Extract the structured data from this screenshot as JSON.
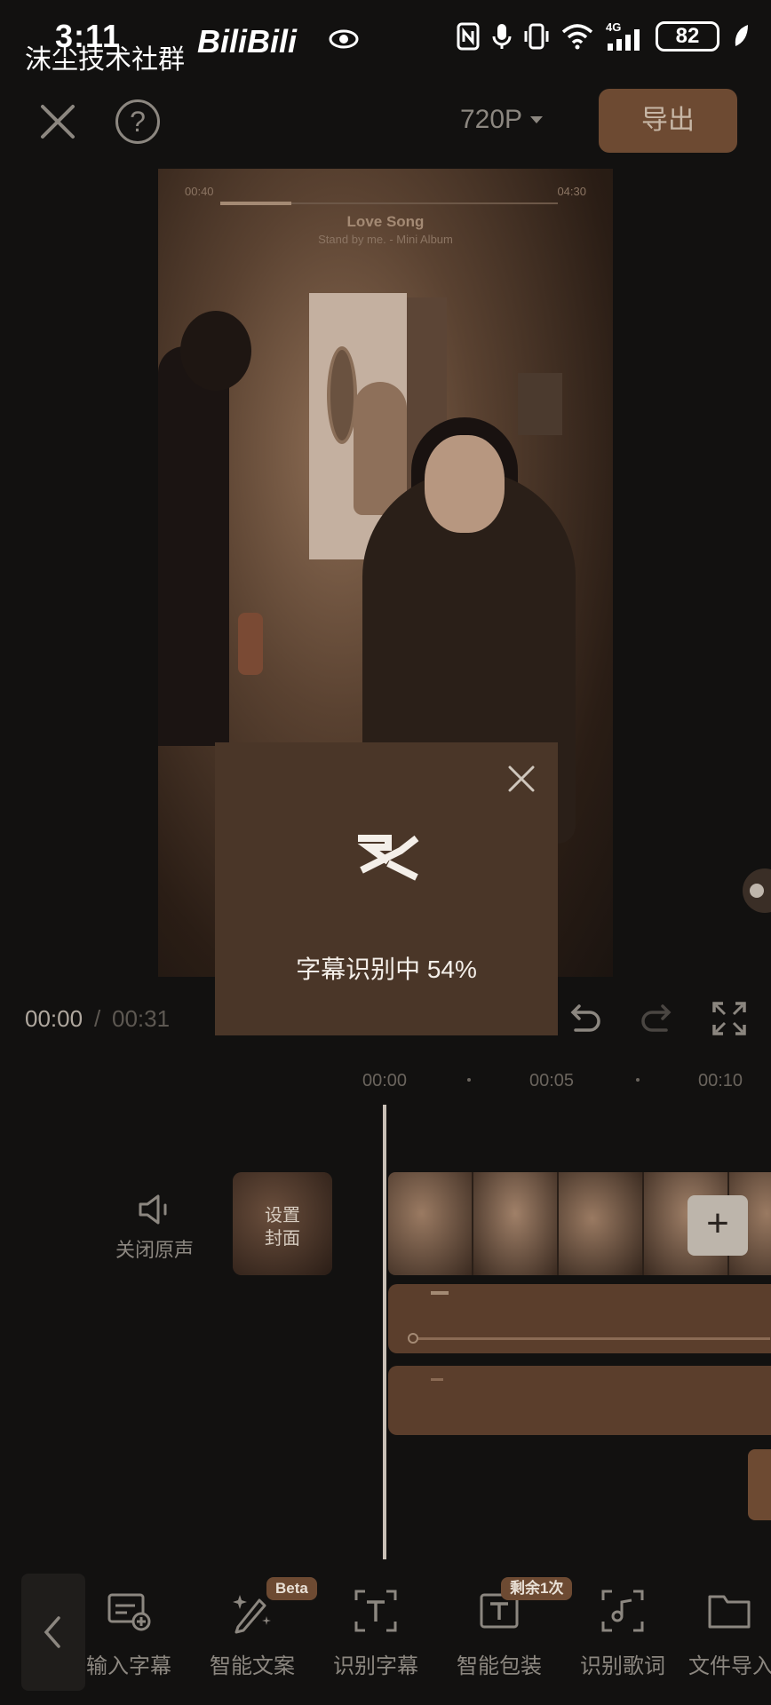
{
  "status_bar": {
    "time": "3:11",
    "watermark": "沫尘技术社群",
    "app_logo": "BiliBili",
    "battery": "82",
    "network": "4G"
  },
  "header": {
    "resolution": "720P",
    "export_label": "导出"
  },
  "preview": {
    "music_time_left": "00:40",
    "music_time_right": "04:30",
    "song_title": "Love Song",
    "song_subtitle": "Stand by me. - Mini Album"
  },
  "dialog": {
    "text": "字幕识别中 54%",
    "progress": 54
  },
  "playback": {
    "current": "00:00",
    "separator": "/",
    "total": "00:31"
  },
  "ruler": {
    "labels": [
      "00:00",
      "00:05",
      "00:10"
    ]
  },
  "tracks": {
    "mute_label": "关闭原声",
    "cover_label_1": "设置",
    "cover_label_2": "封面",
    "add_label": "+"
  },
  "toolbar": {
    "items": [
      {
        "label": "输入字幕",
        "icon": "input-subtitle-icon"
      },
      {
        "label": "智能文案",
        "icon": "smart-copy-icon",
        "badge": "Beta"
      },
      {
        "label": "识别字幕",
        "icon": "recognize-subtitle-icon"
      },
      {
        "label": "智能包装",
        "icon": "smart-package-icon",
        "badge": "剩余1次"
      },
      {
        "label": "识别歌词",
        "icon": "recognize-lyrics-icon"
      },
      {
        "label": "文件导入",
        "icon": "file-import-icon"
      }
    ]
  },
  "colors": {
    "accent": "#6d4a32",
    "background": "#121110",
    "dialog": "#4a3628"
  }
}
